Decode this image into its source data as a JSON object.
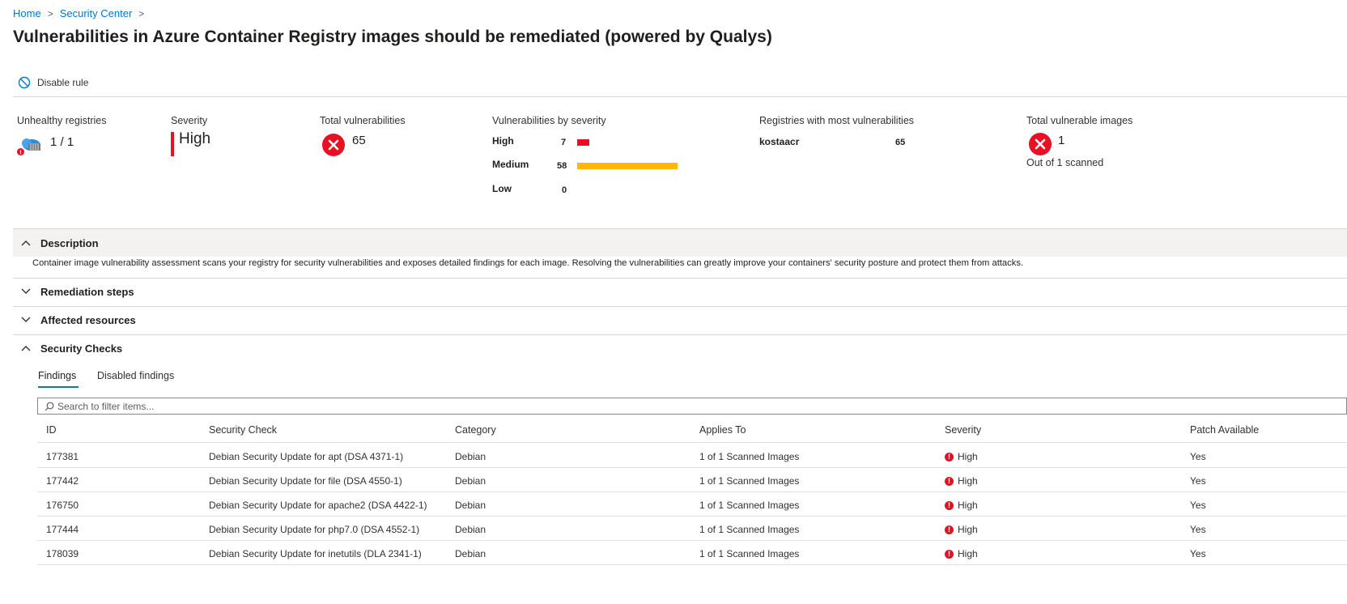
{
  "breadcrumb": {
    "home": "Home",
    "security_center": "Security Center"
  },
  "page_title": "Vulnerabilities in Azure Container Registry images should be remediated (powered by Qualys)",
  "toolbar": {
    "disable_rule": "Disable rule"
  },
  "kpis": {
    "unhealthy_registries": {
      "label": "Unhealthy registries",
      "value": "1 / 1"
    },
    "severity": {
      "label": "Severity",
      "value": "High"
    },
    "total_vulnerabilities": {
      "label": "Total vulnerabilities",
      "value": "65"
    },
    "by_severity": {
      "label": "Vulnerabilities by severity",
      "rows": [
        {
          "label": "High",
          "count": "7",
          "color": "#e81123"
        },
        {
          "label": "Medium",
          "count": "58",
          "color": "#ffb900"
        },
        {
          "label": "Low",
          "count": "0",
          "color": "#605e5c"
        }
      ]
    },
    "registries_most": {
      "label": "Registries with most vulnerabilities",
      "name": "kostaacr",
      "count": "65"
    },
    "total_vulnerable_images": {
      "label": "Total vulnerable images",
      "value": "1",
      "sub": "Out of 1 scanned"
    }
  },
  "sections": {
    "description": {
      "title": "Description",
      "text": "Container image vulnerability assessment scans your registry for security vulnerabilities and exposes detailed findings for each image. Resolving the vulnerabilities can greatly improve your containers' security posture and protect them from attacks."
    },
    "remediation": {
      "title": "Remediation steps"
    },
    "affected": {
      "title": "Affected resources"
    },
    "security_checks": {
      "title": "Security Checks"
    }
  },
  "tabs": {
    "findings": "Findings",
    "disabled": "Disabled findings"
  },
  "search": {
    "placeholder": "Search to filter items..."
  },
  "table": {
    "headers": {
      "id": "ID",
      "check": "Security Check",
      "category": "Category",
      "applies": "Applies To",
      "severity": "Severity",
      "patch": "Patch Available"
    },
    "rows": [
      {
        "id": "177381",
        "check": "Debian Security Update for apt (DSA 4371-1)",
        "category": "Debian",
        "applies": "1 of 1 Scanned Images",
        "severity": "High",
        "patch": "Yes"
      },
      {
        "id": "177442",
        "check": "Debian Security Update for file (DSA 4550-1)",
        "category": "Debian",
        "applies": "1 of 1 Scanned Images",
        "severity": "High",
        "patch": "Yes"
      },
      {
        "id": "176750",
        "check": "Debian Security Update for apache2 (DSA 4422-1)",
        "category": "Debian",
        "applies": "1 of 1 Scanned Images",
        "severity": "High",
        "patch": "Yes"
      },
      {
        "id": "177444",
        "check": "Debian Security Update for php7.0 (DSA 4552-1)",
        "category": "Debian",
        "applies": "1 of 1 Scanned Images",
        "severity": "High",
        "patch": "Yes"
      },
      {
        "id": "178039",
        "check": "Debian Security Update for inetutils (DLA 2341-1)",
        "category": "Debian",
        "applies": "1 of 1 Scanned Images",
        "severity": "High",
        "patch": "Yes"
      }
    ]
  },
  "colors": {
    "accent": "#0078d4",
    "error": "#e81123",
    "warning": "#ffb900"
  },
  "icons": {
    "disable": "disable-icon",
    "registry": "registry-cloud-icon",
    "error": "error-circle-icon",
    "chevron": "chevron-icon",
    "search": "search-icon"
  }
}
